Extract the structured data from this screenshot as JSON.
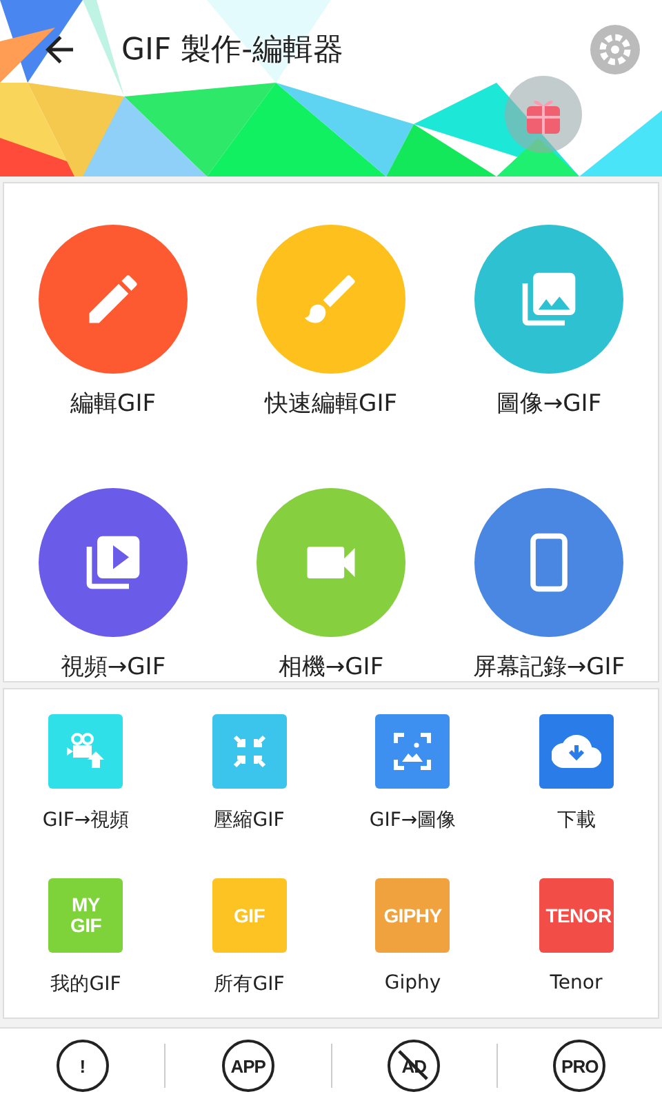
{
  "header": {
    "title": "GIF 製作-編輯器"
  },
  "main_tools": [
    {
      "label": "編輯GIF",
      "color": "#fe5a32"
    },
    {
      "label": "快速編輯GIF",
      "color": "#fdc01c"
    },
    {
      "label": "圖像→GIF",
      "color": "#2ec1d1"
    },
    {
      "label": "視頻→GIF",
      "color": "#6a5be9"
    },
    {
      "label": "相機→GIF",
      "color": "#86cf3e"
    },
    {
      "label": "屏幕記錄→GIF",
      "color": "#4a87e2"
    }
  ],
  "more_tools": [
    {
      "label": "GIF→視頻",
      "kind": "icon",
      "color": "#2fe0e9"
    },
    {
      "label": "壓縮GIF",
      "kind": "icon",
      "color": "#3bc5ec"
    },
    {
      "label": "GIF→圖像",
      "kind": "icon",
      "color": "#3d8ff0"
    },
    {
      "label": "下載",
      "kind": "icon",
      "color": "#2a7de9"
    },
    {
      "label": "我的GIF",
      "kind": "text",
      "text": "MY GIF",
      "color": "#7ed23a"
    },
    {
      "label": "所有GIF",
      "kind": "text",
      "text": "GIF",
      "color": "#fdc322"
    },
    {
      "label": "Giphy",
      "kind": "text",
      "text": "GIPHY",
      "color": "#f0a23e"
    },
    {
      "label": "Tenor",
      "kind": "text",
      "text": "TENOR",
      "color": "#f24d46"
    }
  ],
  "bottom_bar": [
    {
      "text": "!",
      "crossed": false
    },
    {
      "text": "APP",
      "crossed": false
    },
    {
      "text": "AD",
      "crossed": true
    },
    {
      "text": "PRO",
      "crossed": false
    }
  ]
}
